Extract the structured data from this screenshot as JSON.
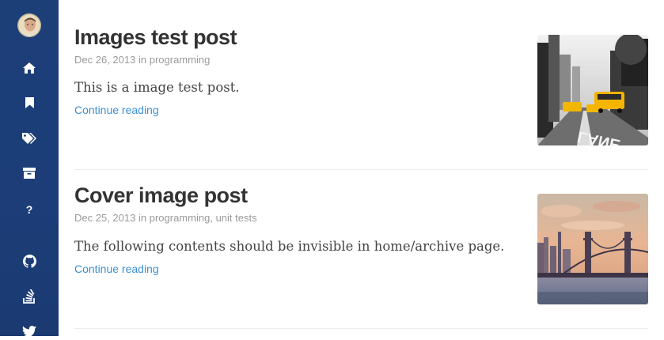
{
  "sidebar": {
    "avatar_icon": "user-avatar",
    "items": [
      {
        "name": "home",
        "icon": "home-icon"
      },
      {
        "name": "bookmarks",
        "icon": "bookmark-icon"
      },
      {
        "name": "tags",
        "icon": "tags-icon"
      },
      {
        "name": "archive",
        "icon": "archive-icon"
      },
      {
        "name": "about",
        "icon": "question-icon",
        "glyph": "?"
      },
      {
        "name": "github",
        "icon": "github-icon"
      },
      {
        "name": "stackoverflow",
        "icon": "stackoverflow-icon"
      },
      {
        "name": "twitter",
        "icon": "twitter-icon"
      }
    ],
    "background_color": "#1c3d78"
  },
  "posts": [
    {
      "title": "Images test post",
      "date": "Dec 26, 2013",
      "in_word": "in",
      "categories": [
        "programming"
      ],
      "excerpt": "This is a image test post.",
      "read_more": "Continue reading",
      "thumbnail": "city-street-taxis-thumbnail"
    },
    {
      "title": "Cover image post",
      "date": "Dec 25, 2013",
      "in_word": "in",
      "categories": [
        "programming",
        "unit tests"
      ],
      "excerpt": "The following contents should be invisible in home/archive page.",
      "read_more": "Continue reading",
      "thumbnail": "bridge-skyline-thumbnail"
    }
  ],
  "colors": {
    "title": "#333333",
    "meta": "#9a9a9a",
    "link": "#3d8fd1",
    "divider": "#ececec"
  }
}
